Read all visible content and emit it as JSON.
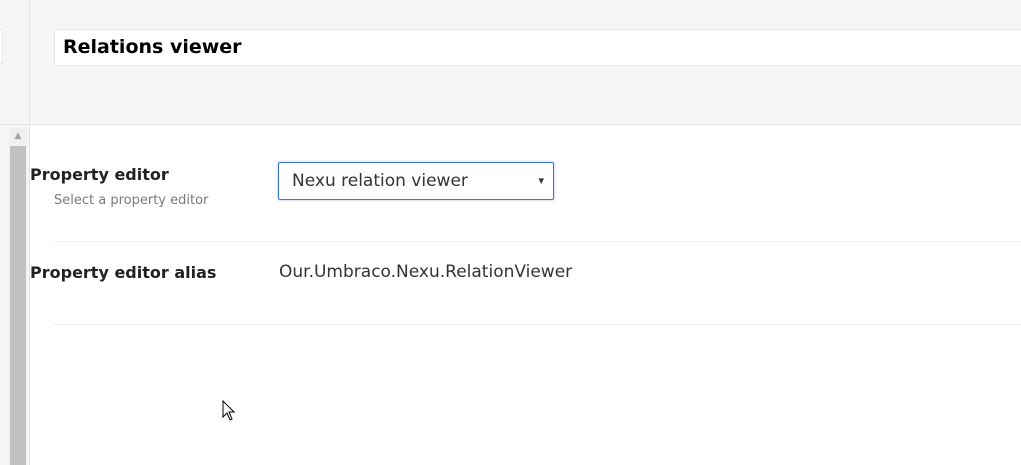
{
  "header": {
    "name_value": "Relations viewer"
  },
  "property_editor": {
    "label": "Property editor",
    "description": "Select a property editor",
    "selected_value": "Nexu relation viewer",
    "dropdown_arrow": "▾"
  },
  "property_editor_alias": {
    "label": "Property editor alias",
    "value": "Our.Umbraco.Nexu.RelationViewer"
  },
  "scrollbar": {
    "up_arrow": "▲"
  },
  "icons": {
    "cursor": "mouse-pointer-icon",
    "dropdown": "caret-down-icon",
    "scroll_up": "triangle-up-icon"
  },
  "colors": {
    "focus_border": "#3879d9",
    "panel_background": "#f6f6f6",
    "scroll_thumb": "#c1c1c1"
  }
}
